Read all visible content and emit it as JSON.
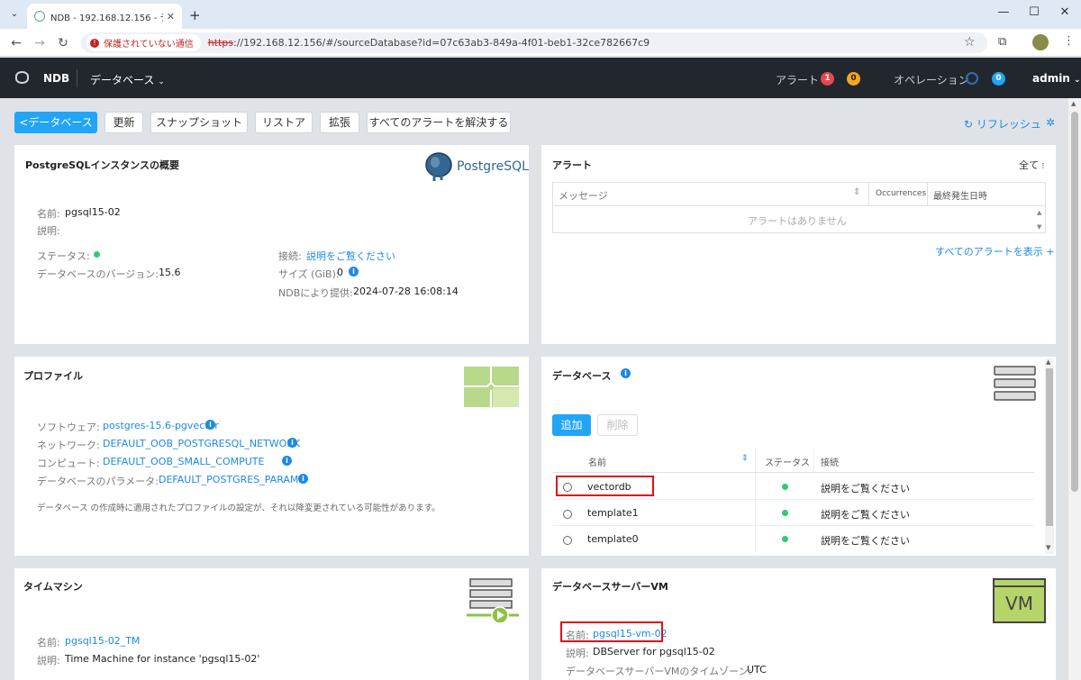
{
  "browser": {
    "tab_title": "NDB - 192.168.12.156 - データベ",
    "security_label": "保護されていない通信",
    "url_scheme": "https",
    "url_rest": "://192.168.12.156/#/sourceDatabase?id=07c63ab3-849a-4f01-beb1-32ce782667c9"
  },
  "header": {
    "app_name": "NDB",
    "menu_label": "データベース",
    "alerts_label": "アラート",
    "alerts_red_count": "1",
    "alerts_yellow_count": "0",
    "operations_label": "オペレーション",
    "operations_count": "0",
    "user": "admin"
  },
  "toolbar": {
    "back_label": "<データベース",
    "buttons": [
      "更新",
      "スナップショット",
      "リストア",
      "拡張",
      "すべてのアラートを解決する"
    ],
    "refresh_label": "リフレッシュ"
  },
  "overview": {
    "title": "PostgreSQLインスタンスの概要",
    "logo_text": "PostgreSQL",
    "name_label": "名前:",
    "name_value": "pgsql15-02",
    "desc_label": "説明:",
    "status_label": "ステータス:",
    "version_label": "データベースのバージョン:",
    "version_value": "15.6",
    "conn_label": "接続:",
    "conn_value": "説明をご覧ください",
    "size_label": "サイズ (GiB):",
    "size_value": "0",
    "provided_label": "NDBにより提供:",
    "provided_value": "2024-07-28 16:08:14"
  },
  "alerts_panel": {
    "title": "アラート",
    "filter": "全て",
    "col_message": "メッセージ",
    "col_occurrences": "Occurrences",
    "col_last": "最終発生日時",
    "empty": "アラートはありません",
    "view_all": "すべてのアラートを表示"
  },
  "profile": {
    "title": "プロファイル",
    "software_label": "ソフトウェア:",
    "software_value": "postgres-15.6-pgvector",
    "network_label": "ネットワーク:",
    "network_value": "DEFAULT_OOB_POSTGRESQL_NETWORK",
    "compute_label": "コンピュート:",
    "compute_value": "DEFAULT_OOB_SMALL_COMPUTE",
    "params_label": "データベースのパラメータ:",
    "params_value": "DEFAULT_POSTGRES_PARAMS",
    "note": "データベース の作成時に適用されたプロファイルの設定が、それ以降変更されている可能性があります。"
  },
  "databases": {
    "title": "データベース",
    "add_label": "追加",
    "delete_label": "削除",
    "col_name": "名前",
    "col_status": "ステータス",
    "col_conn": "接続",
    "rows": [
      {
        "name": "vectordb",
        "conn": "説明をご覧ください"
      },
      {
        "name": "template1",
        "conn": "説明をご覧ください"
      },
      {
        "name": "template0",
        "conn": "説明をご覧ください"
      }
    ]
  },
  "timemachine": {
    "title": "タイムマシン",
    "name_label": "名前:",
    "name_value": "pgsql15-02_TM",
    "desc_label": "説明:",
    "desc_value": "Time Machine for instance 'pgsql15-02'"
  },
  "dbserver": {
    "title": "データベースサーバーVM",
    "icon_text": "VM",
    "name_label": "名前:",
    "name_value": "pgsql15-vm-02",
    "desc_label": "説明:",
    "desc_value": "DBServer for pgsql15-02",
    "tz_label": "データベースサーバーVMのタイムゾーン:",
    "tz_value": "UTC"
  },
  "colors": {
    "accent": "#22a5f7",
    "link": "#1e88e5",
    "alert_red": "#e5484d",
    "alert_yellow": "#f5a623",
    "status_green": "#2ecc71",
    "highlight": "#e0101a"
  }
}
